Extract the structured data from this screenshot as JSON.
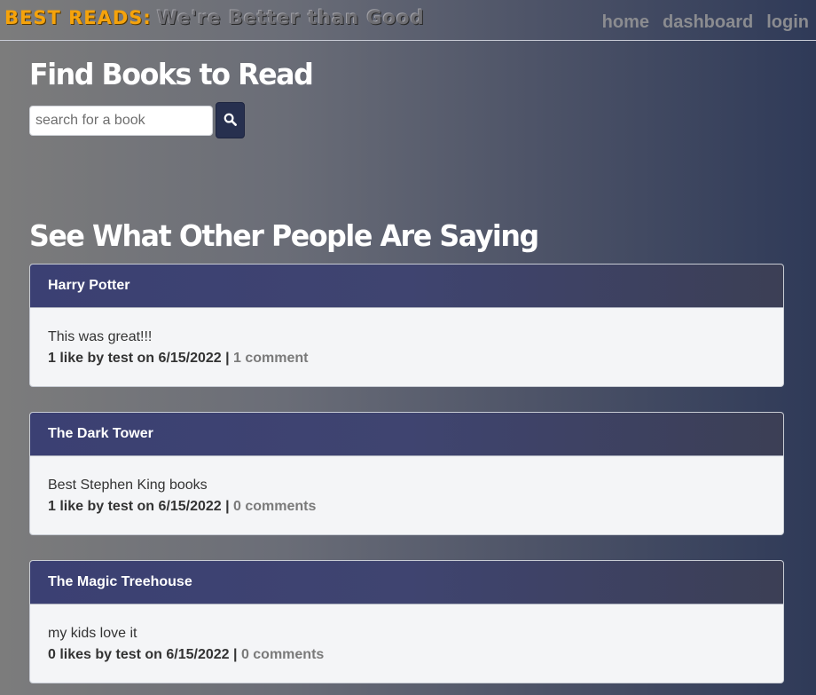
{
  "header": {
    "brand": "BEST READS:",
    "tagline": "We're Better than Good",
    "nav": [
      "home",
      "dashboard",
      "login"
    ]
  },
  "search": {
    "title": "Find Books to Read",
    "placeholder": "search for a book",
    "button_icon": "search-icon"
  },
  "reviews": {
    "title": "See What Other People Are Saying",
    "items": [
      {
        "book": "Harry Potter",
        "text": "This was great!!!",
        "meta": "1 like by test on 6/15/2022 | ",
        "comments": "1 comment"
      },
      {
        "book": "The Dark Tower",
        "text": "Best Stephen King books",
        "meta": "1 like by test on 6/15/2022 | ",
        "comments": "0 comments"
      },
      {
        "book": "The Magic Treehouse",
        "text": "my kids love it",
        "meta": "0 likes by test on 6/15/2022 | ",
        "comments": "0 comments"
      }
    ]
  },
  "colors": {
    "brand": "#f5a30b",
    "accent": "#27304f",
    "card_header": "#3b4073"
  }
}
